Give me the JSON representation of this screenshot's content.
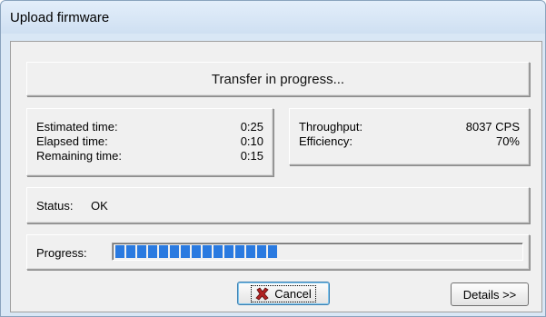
{
  "window": {
    "title": "Upload firmware"
  },
  "header": {
    "text": "Transfer in progress..."
  },
  "timing": {
    "estimated_label": "Estimated time:",
    "estimated_value": "0:25",
    "elapsed_label": "Elapsed time:",
    "elapsed_value": "0:10",
    "remaining_label": "Remaining time:",
    "remaining_value": "0:15"
  },
  "performance": {
    "throughput_label": "Throughput:",
    "throughput_value": "8037 CPS",
    "efficiency_label": "Efficiency:",
    "efficiency_value": "70%"
  },
  "status": {
    "label": "Status:",
    "value": "OK"
  },
  "progress": {
    "label": "Progress:",
    "fraction": 0.4
  },
  "buttons": {
    "cancel_label": "Cancel",
    "details_label": "Details >>"
  },
  "colors": {
    "progress": "#2a7ae0",
    "cancel_icon": "#b22222"
  },
  "icons": {
    "cancel": "x-icon"
  }
}
